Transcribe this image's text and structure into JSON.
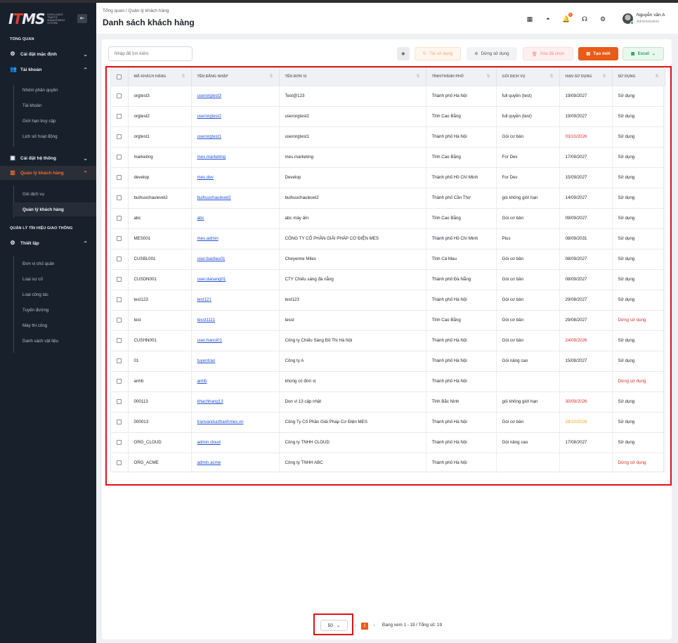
{
  "logo": {
    "main": "I",
    "accent": "T",
    "rest": "MS",
    "sub": "INTELLIGENT TRAFFIC MANAGEMENT SYSTEM"
  },
  "sidebar": {
    "section1": "TỔNG QUAN",
    "section2": "QUẢN LÝ TÍN HIỆU GIAO THÔNG",
    "menu": {
      "settings_default": "Cài đặt mặc định",
      "account": "Tài khoản",
      "system_settings": "Cài đặt hệ thống",
      "customer_mgmt": "Quản lý khách hàng",
      "setup": "Thiết lập"
    },
    "account_items": [
      "Nhóm phân quyền",
      "Tài khoản",
      "Giới hạn truy cập",
      "Lịch sử hoạt động"
    ],
    "customer_items": [
      "Gói dịch vụ",
      "Quản lý khách hàng"
    ],
    "setup_items": [
      "Đơn vị chủ quản",
      "Loại sự cố",
      "Loại công tác",
      "Tuyến đường",
      "Máy thi công",
      "Danh sách vật liệu"
    ]
  },
  "header": {
    "breadcrumb": "Tổng quan  /  Quản lý khách hàng",
    "title": "Danh sách khách hàng",
    "notification_count": "1",
    "user_name": "Nguyễn văn A",
    "user_role": "Administrators"
  },
  "toolbar": {
    "search_placeholder": "Nhập để tìm kiếm",
    "reuse_label": "Tái sử dụng",
    "stop_label": "Dừng sử dụng",
    "delete_label": "Xóa đã chọn",
    "new_label": "Tạo mới",
    "excel_label": "Excel"
  },
  "table": {
    "columns": [
      "MÃ KHÁCH HÀNG",
      "TÊN ĐĂNG NHẬP",
      "TÊN ĐƠN VỊ",
      "TỈNH/THÀNH PHỐ",
      "GÓI DỊCH VỤ",
      "HẠN SỬ DỤNG",
      "SỬ DỤNG"
    ],
    "rows": [
      [
        "orgtest3",
        "userorgtest3",
        "Test@123",
        "Thành phố Hà Nội",
        "full quyền (test)",
        "19/09/2027",
        "Sử dụng"
      ],
      [
        "orgtest2",
        "userorgtest2",
        "userorgtest2",
        "Tỉnh Cao Bằng",
        "full quyền (test)",
        "19/09/2027",
        "Sử dụng"
      ],
      [
        "orgtest1",
        "userorgtest1",
        "userorgtest1",
        "Thành phố Hà Nội",
        "Gói cơ bản",
        "03/10/2026",
        "Sử dụng"
      ],
      [
        "marketing",
        "mes.marketing",
        "mes.marketing",
        "Tỉnh Cao Bằng",
        "For Dev",
        "17/09/2027",
        "Sử dụng"
      ],
      [
        "develop",
        "mes.dev",
        "Develop",
        "Thành phố Hồ Chí Minh",
        "For Dev",
        "15/09/2027",
        "Sử dụng"
      ],
      [
        "buihuuchaulevel2",
        "buihuuchaulevel2",
        "buihuuchaulevel2",
        "Thành phố Cần Thơ",
        "gói không giới hạn",
        "14/09/2027",
        "Sử dụng"
      ],
      [
        "abc",
        "abc",
        "abc máy ấm",
        "Tỉnh Cao Bằng",
        "Gói cơ bản",
        "09/09/2027",
        "Sử dụng"
      ],
      [
        "MES001",
        "mes.admin",
        "CÔNG TY CỔ PHẦN GIẢI PHÁP CƠ ĐIỆN MES",
        "Thành phố Hồ Chí Minh",
        "Plus",
        "08/09/2031",
        "Sử dụng"
      ],
      [
        "CUSBL001",
        "user.baclieu01",
        "Cheyenne Miles",
        "Tỉnh Cà Mau",
        "Gói cơ bản",
        "08/09/2027",
        "Sử dụng"
      ],
      [
        "CUSDN001",
        "user.danang01",
        "CTY Chiếu sáng đà nẵng",
        "Thành phố Đà Nẵng",
        "Gói cơ bản",
        "08/09/2027",
        "Sử dụng"
      ],
      [
        "test123",
        "test121",
        "test123",
        "Thành phố Hà Nội",
        "Gói cơ bản",
        "29/08/2027",
        "Sử dụng"
      ],
      [
        "test",
        "tesst1111",
        "tesst",
        "Tỉnh Cao Bằng",
        "Gói cơ bản",
        "29/08/2027",
        "Dừng sử dụng"
      ],
      [
        "CUSHN001",
        "user.hanoi01",
        "Công ty Chiếu Sáng Đô Thị Hà Nội",
        "Thành phố Hà Nội",
        "Gói cơ bản",
        "24/09/2026",
        "Sử dụng"
      ],
      [
        "01",
        "tuyentran",
        "Công ty A",
        "Thành phố Hà Nội",
        "Gói nâng cao",
        "15/08/2027",
        "Sử dụng"
      ],
      [
        "anhb",
        "anhb",
        "khong có đơn vị",
        "Thành phố Hà Nội",
        "",
        "",
        "Dừng sử dụng"
      ],
      [
        "000113",
        "khachhang13",
        "Don vi 13 cập nhật",
        "Tỉnh Bắc Ninh",
        "gói không giới hạn",
        "30/09/2026",
        "Sử dụng"
      ],
      [
        "000013",
        "tranvanducthanhmes.vn",
        "Công Ty Cổ Phần Giải Pháp Cơ Điện MES",
        "Thành phố Hà Nội",
        "Gói cơ bản",
        "28/10/2026",
        "Sử dụng"
      ],
      [
        "ORG_CLOUD",
        "admin.cloud",
        "Công ty TNHH CLOUD",
        "Thành phố Hà Nội",
        "Gói nâng cao",
        "17/08/2027",
        "Sử dụng"
      ],
      [
        "ORG_ACME",
        "admin.acme",
        "Công ty TNHH ABC",
        "Thành phố Hà Nội",
        "",
        "",
        "Dừng sử dụng"
      ]
    ],
    "date_colors": {
      "2": "red",
      "12": "red",
      "15": "red",
      "16": "orange"
    },
    "inactive_label": "Dừng sử dụng"
  },
  "pagination": {
    "page_size": "50",
    "current_page": "1",
    "info": "Đang xem 1 - 19 / Tổng số: 19"
  },
  "colors": {
    "accent": "#ea5a18",
    "sidebar_bg": "#18202c",
    "link": "#2250d6",
    "danger": "#e02b2b",
    "warning": "#f1a32b"
  }
}
